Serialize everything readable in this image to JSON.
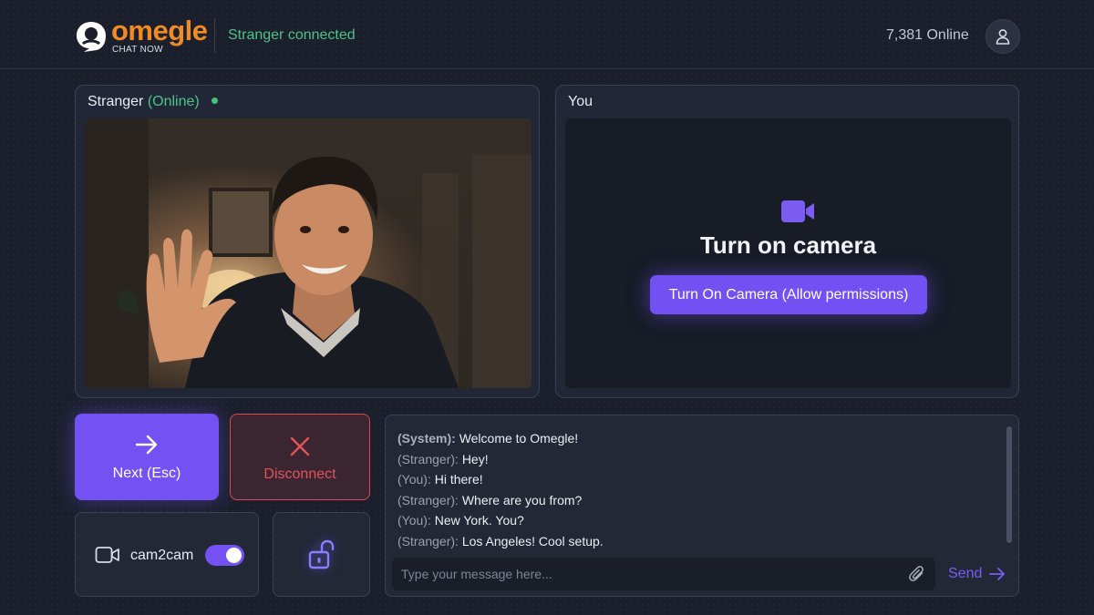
{
  "header": {
    "logo_word": "omegle",
    "logo_sub": "CHAT NOW",
    "status": "Stranger connected",
    "online_count": "7,381 Online"
  },
  "stranger_panel": {
    "title": "Stranger",
    "status": "(Online)"
  },
  "you_panel": {
    "title": "You",
    "camera_heading": "Turn on camera",
    "camera_button": "Turn On Camera (Allow permissions)"
  },
  "controls": {
    "next_label": "Next (Esc)",
    "disconnect_label": "Disconnect",
    "cam2cam_label": "cam2cam",
    "cam2cam_enabled": true
  },
  "chat": {
    "messages": [
      {
        "who": "(System):",
        "text": "Welcome to Omegle!"
      },
      {
        "who": "(Stranger):",
        "text": "Hey!"
      },
      {
        "who": "(You):",
        "text": "Hi there!"
      },
      {
        "who": "(Stranger):",
        "text": "Where are you from?"
      },
      {
        "who": "(You):",
        "text": "New York. You?"
      },
      {
        "who": "(Stranger):",
        "text": "Los Angeles! Cool setup."
      }
    ],
    "placeholder": "Type your message here...",
    "send_label": "Send"
  },
  "colors": {
    "accent": "#7351f2",
    "online": "#4cc38a",
    "danger": "#e2545a",
    "brand": "#f08a24"
  },
  "icons": {
    "logo": "omegle-logo-icon",
    "avatar": "user-icon",
    "camera": "video-camera-icon",
    "next": "arrow-right-icon",
    "disconnect": "close-icon",
    "lock": "unlock-icon",
    "attach": "paperclip-icon",
    "send": "arrow-right-icon"
  }
}
